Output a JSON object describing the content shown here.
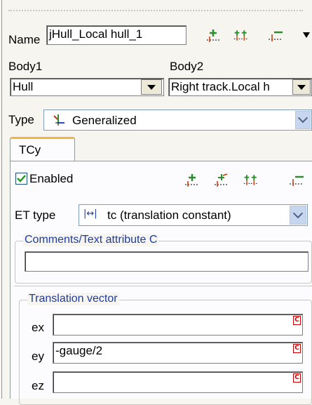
{
  "name_label": "Name",
  "name_value": "jHull_Local hull_1",
  "body1_label": "Body1",
  "body2_label": "Body2",
  "body1_value": "Hull",
  "body2_value": "Right track.Local h",
  "type_label": "Type",
  "type_value": "Generalized",
  "tab_label": "TCy",
  "enabled_label": "Enabled",
  "enabled_checked": true,
  "et_type_label": "ET type",
  "et_type_value": "tc (translation constant)",
  "comments_legend": "Comments/Text attribute C",
  "comments_value": "",
  "translation_legend": "Translation vector",
  "ex_label": "ex",
  "ey_label": "ey",
  "ez_label": "ez",
  "ex_value": "",
  "ey_value": "-gauge/2",
  "ez_value": "",
  "c_badge": "C",
  "colors": {
    "legend_blue": "#1f3b9e",
    "tab_accent": "#f4b53f",
    "check_green": "#2a9a2a",
    "icon_green": "#2e8b2e",
    "icon_red": "#cc3300"
  }
}
